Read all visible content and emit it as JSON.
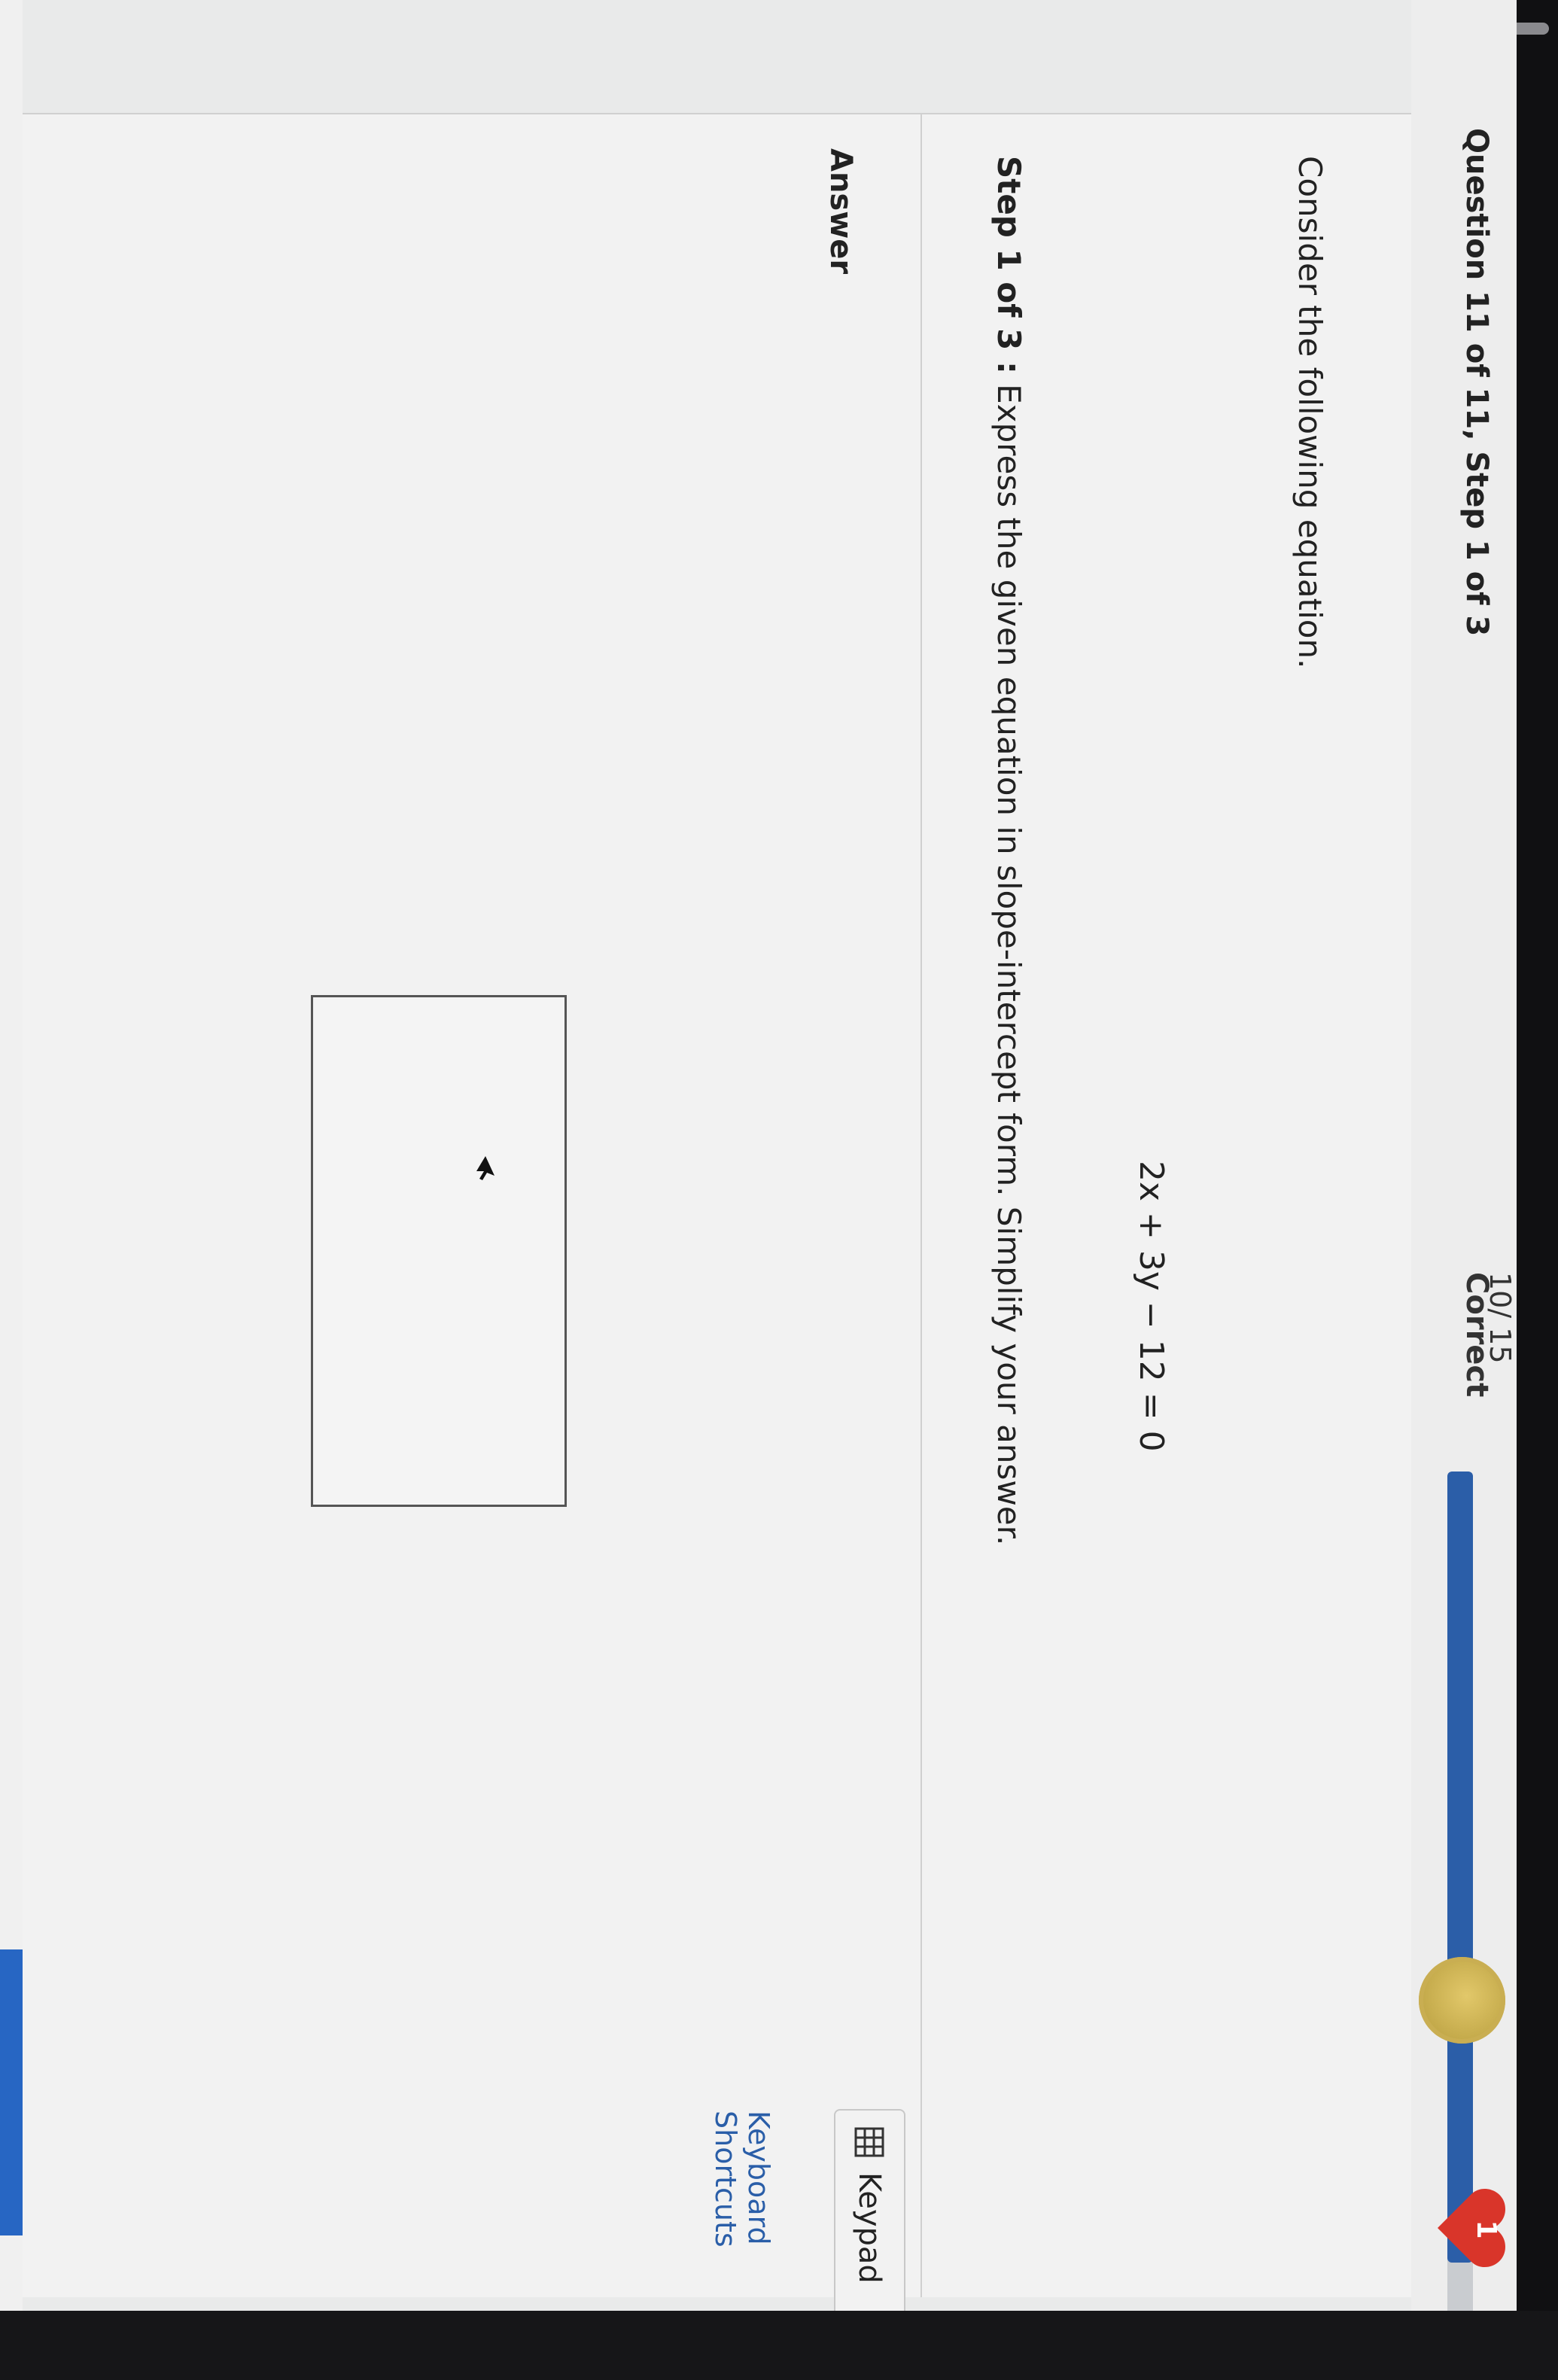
{
  "header": {
    "question_title": "Question 11 of 11, Step 1 of 3",
    "correct_count": "10/ 15",
    "correct_label": "Correct",
    "progress_fraction": 0.93,
    "hearts": "1",
    "colors": {
      "progress": "#2b5ea8",
      "heart": "#d9352a",
      "coin": "#c9ae52"
    }
  },
  "question": {
    "prompt": "Consider the following equation.",
    "equation": "2x + 3y − 12 = 0",
    "step_prefix": "Step 1 of 3 :",
    "step_instruction": " Express the given equation in slope-intercept form. Simplify your answer."
  },
  "answer": {
    "label": "Answer",
    "value": ""
  },
  "tools": {
    "keypad_label": "Keypad",
    "keyboard_shortcuts": "Keyboard Shortcuts",
    "link_color": "#2a5ea8"
  },
  "icons": {
    "coin": "coin-icon",
    "heart": "heart-icon",
    "keypad": "keypad-icon",
    "cursor": "mouse-cursor-icon"
  }
}
